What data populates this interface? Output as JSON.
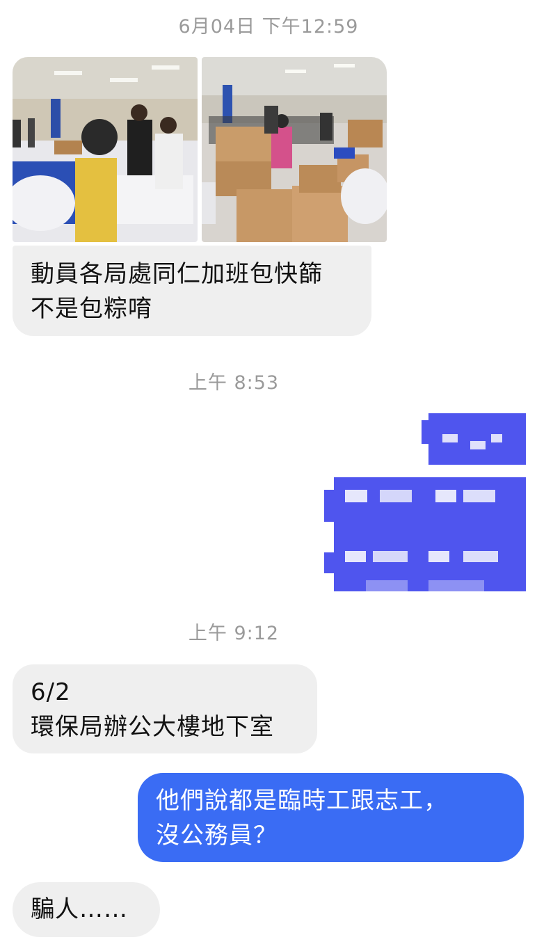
{
  "timestamps": {
    "first": "6月04日 下午12:59",
    "second": "上午 8:53",
    "third": "上午 9:12"
  },
  "messages": {
    "msg1": "動員各局處同仁加班包快篩\n不是包粽唷",
    "msg2": "6/2\n環保局辦公大樓地下室",
    "msg3": "他們說都是臨時工跟志工，\n沒公務員？",
    "msg4": "騙人……"
  },
  "colors": {
    "incoming_bubble": "#efefef",
    "outgoing_bubble": "#3a6cf4",
    "timestamp": "#9a9a9a",
    "censor_blue": "#4f55ee"
  }
}
